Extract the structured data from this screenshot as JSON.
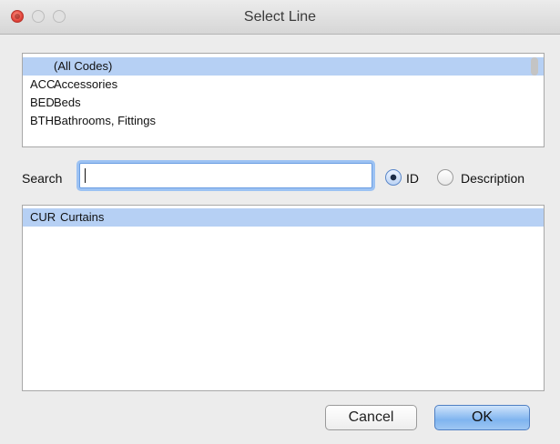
{
  "window": {
    "title": "Select Line"
  },
  "code_list": {
    "items": [
      {
        "code": "",
        "description": "(All Codes)",
        "selected": true
      },
      {
        "code": "ACC",
        "description": "Accessories",
        "selected": false
      },
      {
        "code": "BED",
        "description": "Beds",
        "selected": false
      },
      {
        "code": "BTH",
        "description": "Bathrooms, Fittings",
        "selected": false
      }
    ]
  },
  "search": {
    "label": "Search",
    "value": "",
    "mode_options": [
      {
        "label": "ID",
        "checked": true
      },
      {
        "label": "Description",
        "checked": false
      }
    ]
  },
  "results_list": {
    "items": [
      {
        "code": "CUR",
        "description": "Curtains",
        "selected": true
      }
    ]
  },
  "buttons": {
    "cancel": "Cancel",
    "ok": "OK"
  },
  "colors": {
    "selection": "#b6d0f4",
    "focus_ring": "#9cc2f3",
    "default_button": "#7fb4ef"
  }
}
